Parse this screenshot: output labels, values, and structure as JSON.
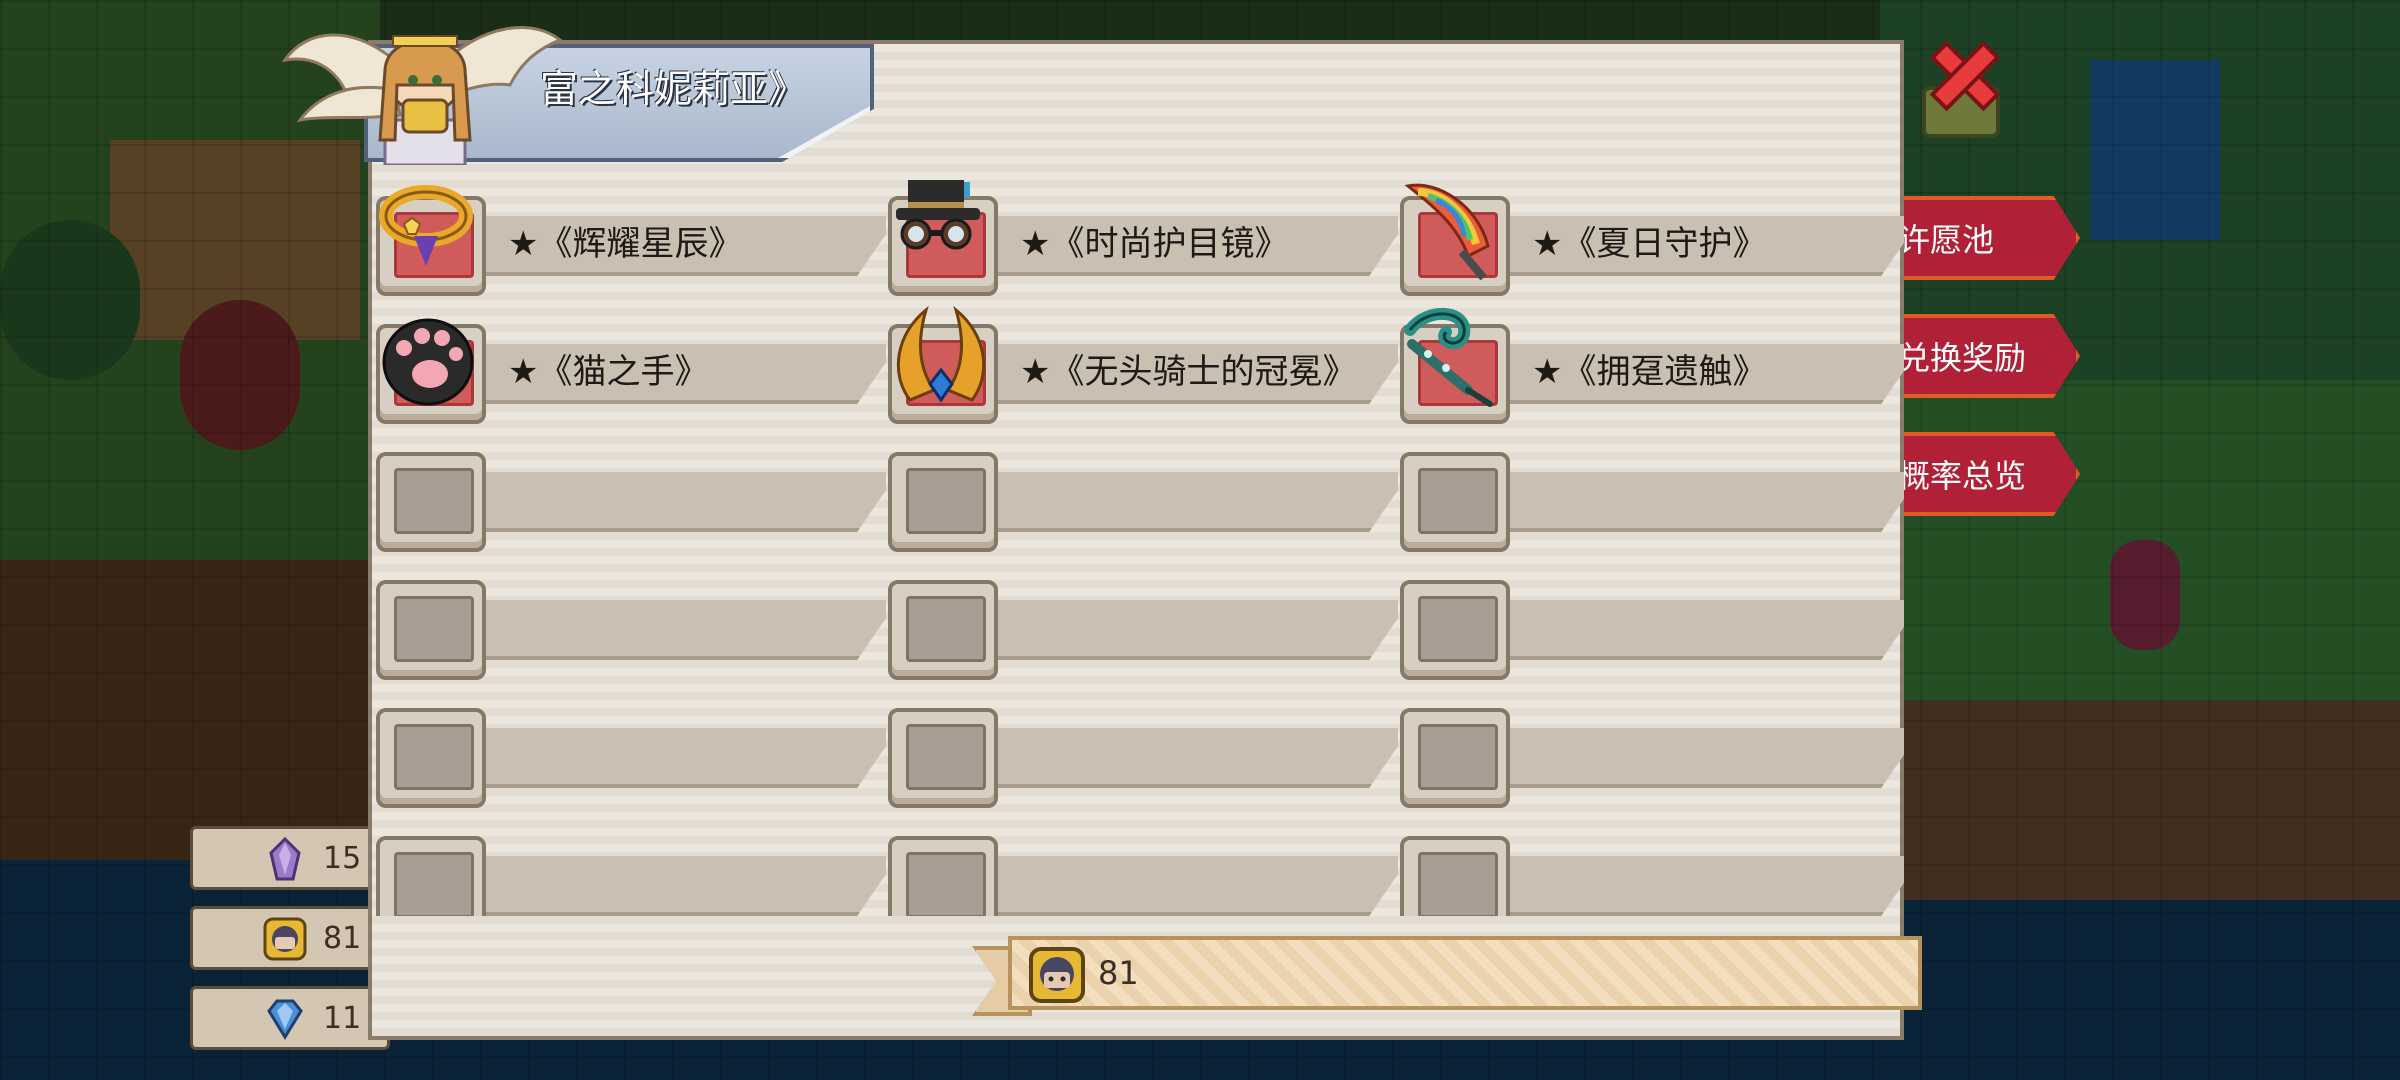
{
  "dialog": {
    "title": "富之科妮莉亚》"
  },
  "items": [
    {
      "label": "★《辉耀星辰》",
      "icon": "golden-ring-icon"
    },
    {
      "label": "★《时尚护目镜》",
      "icon": "goggles-hat-icon"
    },
    {
      "label": "★《夏日守护》",
      "icon": "rainbow-weapon-icon"
    },
    {
      "label": "★《猫之手》",
      "icon": "cat-paw-icon"
    },
    {
      "label": "★《无头骑士的冠冕》",
      "icon": "golden-horns-icon"
    },
    {
      "label": "★《拥趸遗触》",
      "icon": "tentacle-staff-icon"
    },
    {
      "label": ""
    },
    {
      "label": ""
    },
    {
      "label": ""
    },
    {
      "label": ""
    },
    {
      "label": ""
    },
    {
      "label": ""
    },
    {
      "label": ""
    },
    {
      "label": ""
    },
    {
      "label": ""
    },
    {
      "label": ""
    },
    {
      "label": ""
    },
    {
      "label": ""
    }
  ],
  "footer": {
    "token_count": "81",
    "token_icon": "character-token-icon"
  },
  "side_menu": {
    "wish_pool": "许愿池",
    "exchange": "兑换奖励",
    "odds": "概率总览"
  },
  "currencies": [
    {
      "icon": "purple-crystal-icon",
      "value": "15"
    },
    {
      "icon": "character-token-icon",
      "value": "81"
    },
    {
      "icon": "blue-gem-icon",
      "value": "11"
    }
  ],
  "colors": {
    "accent_red": "#b02036",
    "panel": "#ebe6de",
    "title_tab": "#a9b8cc",
    "slot_filled": "#d05b5b"
  }
}
